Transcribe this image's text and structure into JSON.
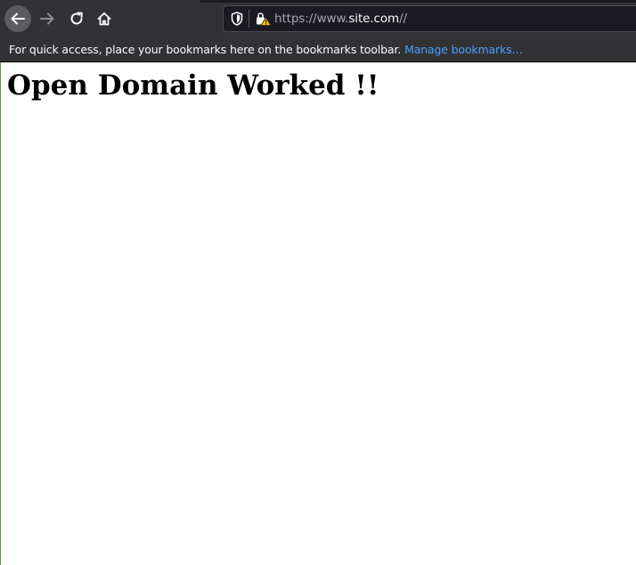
{
  "toolbar": {
    "back_icon": "arrow-left-icon",
    "forward_icon": "arrow-right-icon",
    "reload_icon": "reload-icon",
    "home_icon": "home-icon"
  },
  "urlbar": {
    "scheme": "https://www.",
    "host": "site.com",
    "path": "//",
    "shield_icon": "shield-icon",
    "lock_icon": "insecure-lock-warning-icon"
  },
  "bookmarks": {
    "hint": "For quick access, place your bookmarks here on the bookmarks toolbar.",
    "manage_label": "Manage bookmarks…"
  },
  "page": {
    "heading": "Open Domain Worked !!"
  },
  "colors": {
    "toolbar_bg": "#323234",
    "urlbar_bg": "#1c1b22",
    "link": "#45a1ff",
    "page_bg": "#ffffff"
  }
}
